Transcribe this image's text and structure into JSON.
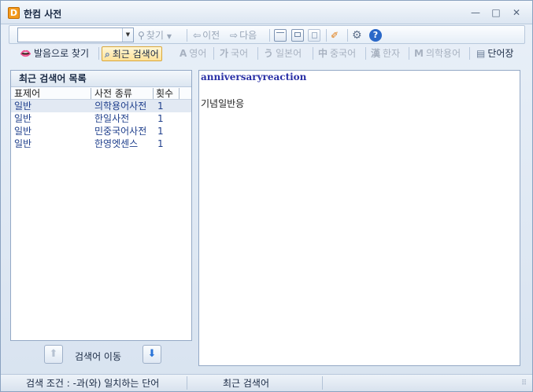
{
  "window": {
    "title": "한컴 사전",
    "logo_letter": "D"
  },
  "window_controls": {
    "minimize": "—",
    "maximize": "□",
    "close": "✕"
  },
  "toolbar": {
    "search_value": "",
    "find_label": "찾기",
    "prev_label": "이전",
    "next_label": "다음"
  },
  "dictionary_tabs": [
    {
      "label": "발음으로 찾기",
      "glyph": "👄",
      "state": "active"
    },
    {
      "label": "최근 검색어",
      "glyph": "⌕",
      "state": "selected"
    },
    {
      "label": "영어",
      "glyph": "A",
      "state": "disabled"
    },
    {
      "label": "국어",
      "glyph": "가",
      "state": "disabled"
    },
    {
      "label": "일본어",
      "glyph": "う",
      "state": "disabled"
    },
    {
      "label": "중국어",
      "glyph": "中",
      "state": "disabled"
    },
    {
      "label": "한자",
      "glyph": "漢",
      "state": "disabled"
    },
    {
      "label": "의학용어",
      "glyph": "M",
      "state": "disabled"
    },
    {
      "label": "단어장",
      "glyph": "▤",
      "state": "active"
    }
  ],
  "recent_list": {
    "title": "최근 검색어 목록",
    "columns": [
      "표제어",
      "사전 종류",
      "횟수"
    ],
    "rows": [
      {
        "headword": "일반",
        "dictionary": "의학용어사전",
        "count": "1"
      },
      {
        "headword": "일반",
        "dictionary": "한일사전",
        "count": "1"
      },
      {
        "headword": "일반",
        "dictionary": "민중국어사전",
        "count": "1"
      },
      {
        "headword": "일반",
        "dictionary": "한영엣센스",
        "count": "1"
      }
    ]
  },
  "move": {
    "label": "검색어 이동"
  },
  "entry": {
    "headword": "anniversaryreaction",
    "meaning": "기념일반응"
  },
  "status": {
    "condition": "검색 조건 : -과(와) 일치하는 단어",
    "mode": "최근 검색어"
  }
}
